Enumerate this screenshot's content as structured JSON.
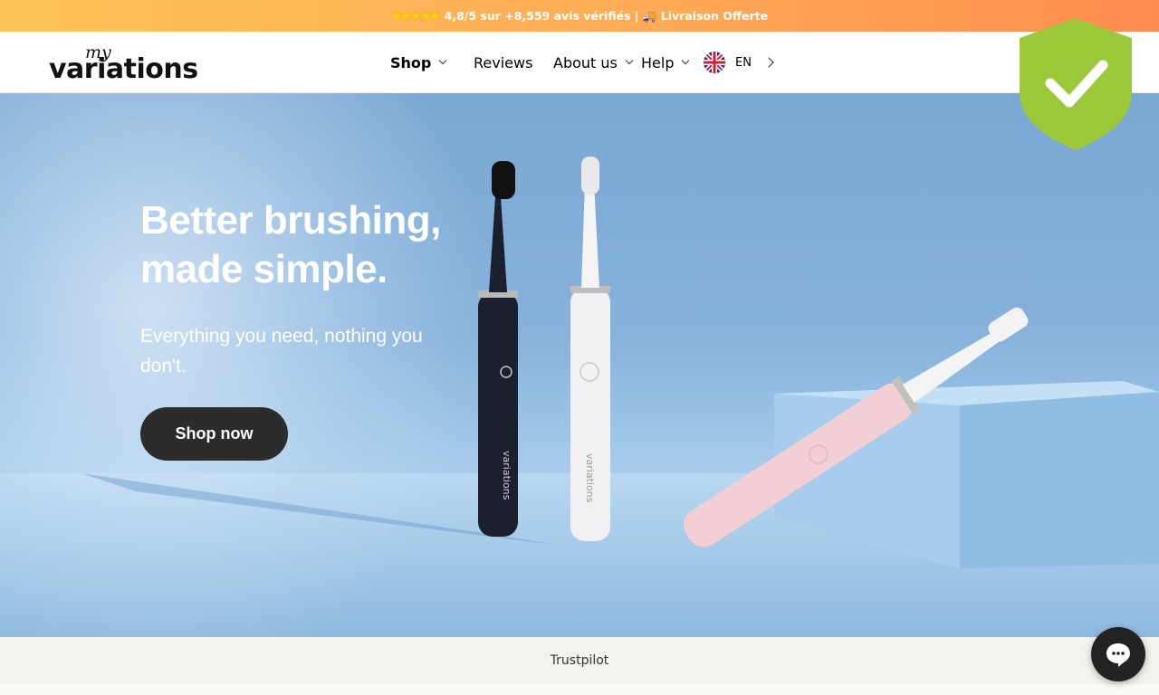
{
  "announcement": {
    "stars": "★★★★★",
    "text": "4,8/5 sur +8,559 avis vérifiés | 🚚 Livraison Offerte"
  },
  "header": {
    "logo_small": "my",
    "logo_main": "variations",
    "nav": {
      "shop": "Shop",
      "reviews": "Reviews",
      "about": "About us",
      "help": "Help",
      "language": "EN"
    }
  },
  "hero": {
    "title": "Better brushing, made simple.",
    "subtitle": "Everything you need, nothing you don't.",
    "cta": "Shop now",
    "brand_on_brush": "variations"
  },
  "trust": {
    "label": "Trustpilot"
  },
  "colors": {
    "announcement_start": "#ffc35a",
    "announcement_end": "#ff8c4f",
    "hero_bg": "#86b2dc",
    "cta_bg": "#2c2c2c",
    "shield": "#9cc93a",
    "trust_bg": "#f4f2ee"
  },
  "icons": {
    "shield": "shield-check-icon",
    "chat": "chat-bubble-icon",
    "flag": "uk-flag-icon"
  }
}
